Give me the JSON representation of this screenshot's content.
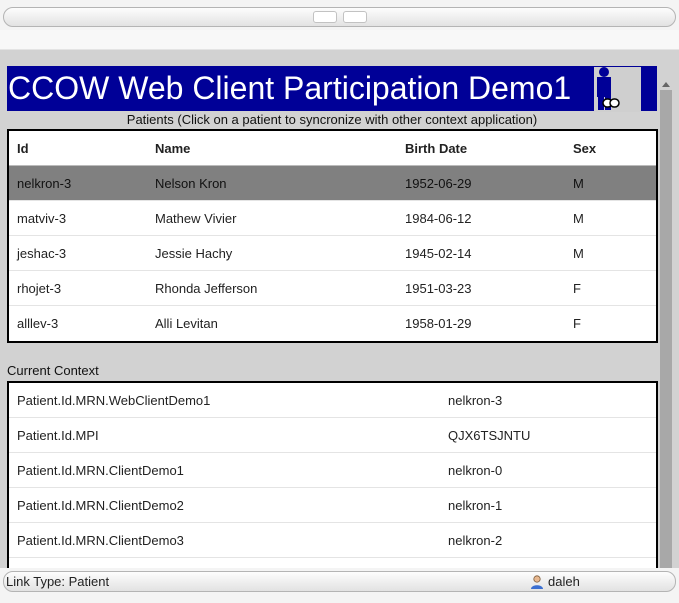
{
  "header": {
    "title": "CCOW Web Client Participation Demo1",
    "accent_color": "#000097",
    "logo_icon": "link-icon"
  },
  "patients": {
    "caption": "Patients (Click on a patient to syncronize with other context application)",
    "columns": [
      "Id",
      "Name",
      "Birth Date",
      "Sex"
    ],
    "rows": [
      {
        "id": "nelkron-3",
        "name": "Nelson Kron",
        "birth_date": "1952-06-29",
        "sex": "M",
        "selected": true
      },
      {
        "id": "matviv-3",
        "name": "Mathew Vivier",
        "birth_date": "1984-06-12",
        "sex": "M"
      },
      {
        "id": "jeshac-3",
        "name": "Jessie Hachy",
        "birth_date": "1945-02-14",
        "sex": "M"
      },
      {
        "id": "rhojet-3",
        "name": "Rhonda Jefferson",
        "birth_date": "1951-03-23",
        "sex": "F"
      },
      {
        "id": "alllev-3",
        "name": "Alli Levitan",
        "birth_date": "1958-01-29",
        "sex": "F"
      }
    ]
  },
  "context": {
    "label": "Current Context",
    "rows": [
      {
        "key": "Patient.Id.MRN.WebClientDemo1",
        "value": "nelkron-3"
      },
      {
        "key": "Patient.Id.MPI",
        "value": "QJX6TSJNTU"
      },
      {
        "key": "Patient.Id.MRN.ClientDemo1",
        "value": "nelkron-0"
      },
      {
        "key": "Patient.Id.MRN.ClientDemo2",
        "value": "nelkron-1"
      },
      {
        "key": "Patient.Id.MRN.ClientDemo3",
        "value": "nelkron-2"
      }
    ]
  },
  "status": {
    "link_type": "Link Type: Patient",
    "user": "daleh",
    "user_icon": "user-icon"
  }
}
